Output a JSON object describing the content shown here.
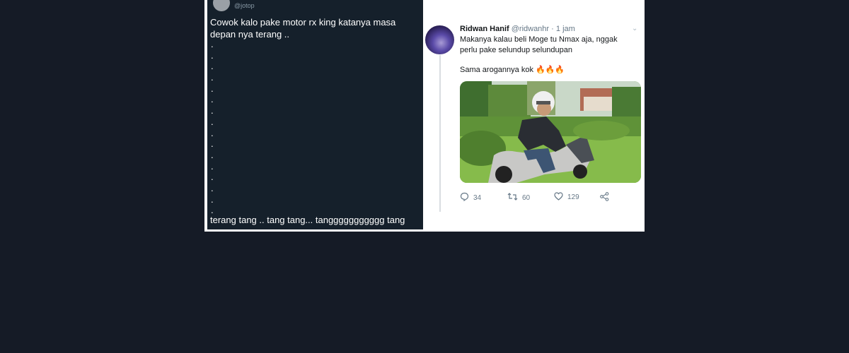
{
  "left_tweet": {
    "handle": "@jotop",
    "text": "Cowok kalo pake motor rx king katanya masa depan nya terang ..",
    "dots": [
      ".",
      ".",
      ".",
      ".",
      ".",
      ".",
      ".",
      ".",
      ".",
      ".",
      ".",
      ".",
      ".",
      ".",
      ".",
      "."
    ],
    "last_line": "terang tang .. tang tang... tanggggggggggg tang"
  },
  "right_tweet": {
    "name": "Ridwan Hanif",
    "handle": "@ridwanhr",
    "separator": "·",
    "time": "1 jam",
    "line1": "Makanya kalau beli Moge tu Nmax aja, nggak perlu pake selundup selundupan",
    "line2": "Sama arogannya kok 🔥🔥🔥",
    "actions": {
      "reply_count": "34",
      "retweet_count": "60",
      "like_count": "129"
    }
  },
  "icons": {
    "reply": "reply-icon",
    "retweet": "retweet-icon",
    "like": "heart-icon",
    "share": "share-icon",
    "menu": "chevron-down-icon"
  }
}
